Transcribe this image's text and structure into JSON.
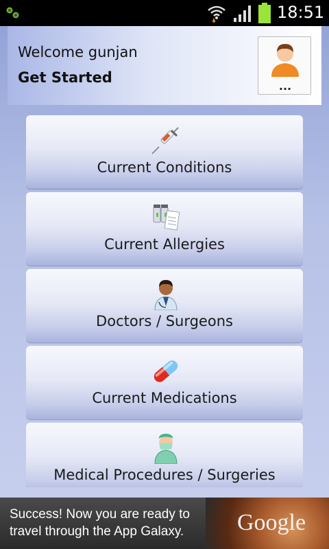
{
  "status_bar": {
    "time": "18:51",
    "icons": [
      "notification-icon",
      "wifi-icon",
      "signal-icon",
      "battery-icon"
    ]
  },
  "header": {
    "welcome": "Welcome gunjan",
    "subtitle": "Get Started",
    "profile_button_label": "..."
  },
  "menu": {
    "items": [
      {
        "label": "Current Conditions",
        "icon": "syringe-icon"
      },
      {
        "label": "Current Allergies",
        "icon": "medicine-bottles-icon"
      },
      {
        "label": "Doctors / Surgeons",
        "icon": "doctor-icon"
      },
      {
        "label": "Current Medications",
        "icon": "pill-capsule-icon"
      },
      {
        "label": "Medical Procedures / Surgeries",
        "icon": "surgeon-icon"
      }
    ]
  },
  "ad": {
    "text_line1": "Success! Now you are ready to",
    "text_line2": "travel through the App Galaxy.",
    "brand": "Google"
  },
  "colors": {
    "background": "#b6c1e6",
    "status_bar": "#000000",
    "battery": "#9ae33a",
    "button_top": "#f7f8fd",
    "button_bottom": "#a9b3dd"
  }
}
